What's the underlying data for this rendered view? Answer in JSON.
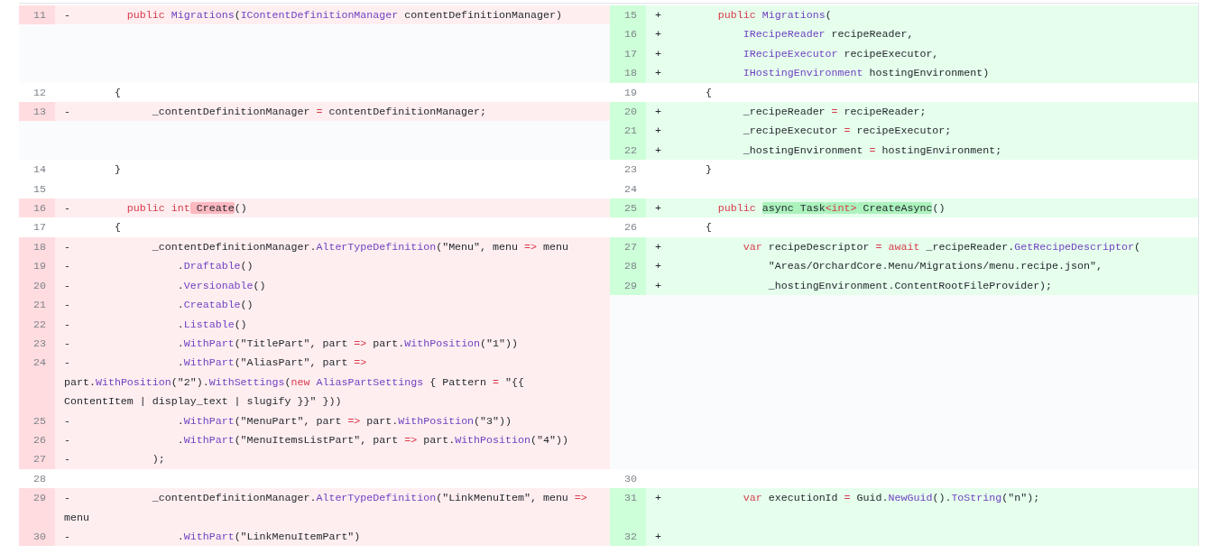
{
  "rows": [
    {
      "left": {
        "number": "11",
        "kind": "del",
        "marker": "-",
        "code": [
          {
            "kind": "keyword",
            "text": "        public"
          },
          {
            "kind": "function",
            "text": " Migrations"
          },
          {
            "kind": "plain",
            "text": "("
          },
          {
            "kind": "function",
            "text": "IContentDefinitionManager"
          },
          {
            "kind": "plain",
            "text": " contentDefinitionManager)"
          }
        ]
      },
      "right": {
        "number": "15",
        "kind": "add",
        "marker": "+",
        "code": [
          {
            "kind": "keyword",
            "text": "        public"
          },
          {
            "kind": "function",
            "text": " Migrations"
          },
          {
            "kind": "plain",
            "text": "("
          }
        ]
      }
    },
    {
      "right": {
        "number": "16",
        "kind": "add",
        "marker": "+",
        "code": [
          {
            "kind": "function",
            "text": "            IRecipeReader"
          },
          {
            "kind": "plain",
            "text": " recipeReader,"
          }
        ]
      }
    },
    {
      "right": {
        "number": "17",
        "kind": "add",
        "marker": "+",
        "code": [
          {
            "kind": "function",
            "text": "            IRecipeExecutor"
          },
          {
            "kind": "plain",
            "text": " recipeExecutor,"
          }
        ]
      }
    },
    {
      "right": {
        "number": "18",
        "kind": "add",
        "marker": "+",
        "code": [
          {
            "kind": "function",
            "text": "            IHostingEnvironment"
          },
          {
            "kind": "plain",
            "text": " hostingEnvironment)"
          }
        ]
      }
    },
    {
      "left": {
        "number": "12",
        "kind": "ctx",
        "code": [
          {
            "kind": "plain",
            "text": "        {"
          }
        ]
      },
      "right": {
        "number": "19",
        "kind": "ctx",
        "code": [
          {
            "kind": "plain",
            "text": "        {"
          }
        ]
      }
    },
    {
      "left": {
        "number": "13",
        "kind": "del",
        "marker": "-",
        "code": [
          {
            "kind": "plain",
            "text": "            _contentDefinitionManager"
          },
          {
            "kind": "keyword",
            "text": " ="
          },
          {
            "kind": "plain",
            "text": " contentDefinitionManager;"
          }
        ]
      },
      "right": {
        "number": "20",
        "kind": "add",
        "marker": "+",
        "code": [
          {
            "kind": "plain",
            "text": "            _recipeReader"
          },
          {
            "kind": "keyword",
            "text": " ="
          },
          {
            "kind": "plain",
            "text": " recipeReader;"
          }
        ]
      }
    },
    {
      "right": {
        "number": "21",
        "kind": "add",
        "marker": "+",
        "code": [
          {
            "kind": "plain",
            "text": "            _recipeExecutor"
          },
          {
            "kind": "keyword",
            "text": " ="
          },
          {
            "kind": "plain",
            "text": " recipeExecutor;"
          }
        ]
      }
    },
    {
      "right": {
        "number": "22",
        "kind": "add",
        "marker": "+",
        "code": [
          {
            "kind": "plain",
            "text": "            _hostingEnvironment"
          },
          {
            "kind": "keyword",
            "text": " ="
          },
          {
            "kind": "plain",
            "text": " hostingEnvironment;"
          }
        ]
      }
    },
    {
      "left": {
        "number": "14",
        "kind": "ctx",
        "code": [
          {
            "kind": "plain",
            "text": "        }"
          }
        ]
      },
      "right": {
        "number": "23",
        "kind": "ctx",
        "code": [
          {
            "kind": "plain",
            "text": "        }"
          }
        ]
      }
    },
    {
      "left": {
        "number": "15",
        "kind": "ctx"
      },
      "right": {
        "number": "24",
        "kind": "ctx"
      }
    },
    {
      "left": {
        "number": "16",
        "kind": "del",
        "marker": "-",
        "code": [
          {
            "kind": "keyword",
            "text": "        public"
          },
          {
            "kind": "keyword",
            "text": " int"
          },
          {
            "kind": "plain",
            "text": " Create",
            "changed": true
          },
          {
            "kind": "plain",
            "text": "()"
          }
        ]
      },
      "right": {
        "number": "25",
        "kind": "add",
        "marker": "+",
        "code": [
          {
            "kind": "keyword",
            "text": "        public "
          },
          {
            "kind": "plain",
            "text": "async Task",
            "changed": true
          },
          {
            "kind": "keyword",
            "text": "<int>",
            "changed": true
          },
          {
            "kind": "plain",
            "text": " CreateAsync",
            "changed": true
          },
          {
            "kind": "plain",
            "text": "()"
          }
        ]
      }
    },
    {
      "left": {
        "number": "17",
        "kind": "ctx",
        "code": [
          {
            "kind": "plain",
            "text": "        {"
          }
        ]
      },
      "right": {
        "number": "26",
        "kind": "ctx",
        "code": [
          {
            "kind": "plain",
            "text": "        {"
          }
        ]
      }
    },
    {
      "left": {
        "number": "18",
        "kind": "del",
        "marker": "-",
        "code": [
          {
            "kind": "plain",
            "text": "            _contentDefinitionManager."
          },
          {
            "kind": "function",
            "text": "AlterTypeDefinition"
          },
          {
            "kind": "plain",
            "text": "(\"Menu\", menu"
          },
          {
            "kind": "keyword",
            "text": " =>"
          },
          {
            "kind": "plain",
            "text": " menu"
          }
        ]
      },
      "right": {
        "number": "27",
        "kind": "add",
        "marker": "+",
        "code": [
          {
            "kind": "keyword",
            "text": "            var"
          },
          {
            "kind": "plain",
            "text": " recipeDescriptor"
          },
          {
            "kind": "keyword",
            "text": " ="
          },
          {
            "kind": "keyword",
            "text": " await"
          },
          {
            "kind": "plain",
            "text": " _recipeReader."
          },
          {
            "kind": "function",
            "text": "GetRecipeDescriptor"
          },
          {
            "kind": "plain",
            "text": "("
          }
        ]
      }
    },
    {
      "left": {
        "number": "19",
        "kind": "del",
        "marker": "-",
        "code": [
          {
            "kind": "plain",
            "text": "                ."
          },
          {
            "kind": "function",
            "text": "Draftable"
          },
          {
            "kind": "plain",
            "text": "()"
          }
        ]
      },
      "right": {
        "number": "28",
        "kind": "add",
        "marker": "+",
        "code": [
          {
            "kind": "plain",
            "text": "                \"Areas/OrchardCore.Menu/Migrations/menu.recipe.json\","
          }
        ]
      }
    },
    {
      "left": {
        "number": "20",
        "kind": "del",
        "marker": "-",
        "code": [
          {
            "kind": "plain",
            "text": "                ."
          },
          {
            "kind": "function",
            "text": "Versionable"
          },
          {
            "kind": "plain",
            "text": "()"
          }
        ]
      },
      "right": {
        "number": "29",
        "kind": "add",
        "marker": "+",
        "code": [
          {
            "kind": "plain",
            "text": "                _hostingEnvironment.ContentRootFileProvider);"
          }
        ]
      }
    },
    {
      "left": {
        "number": "21",
        "kind": "del",
        "marker": "-",
        "code": [
          {
            "kind": "plain",
            "text": "                ."
          },
          {
            "kind": "function",
            "text": "Creatable"
          },
          {
            "kind": "plain",
            "text": "()"
          }
        ]
      }
    },
    {
      "left": {
        "number": "22",
        "kind": "del",
        "marker": "-",
        "code": [
          {
            "kind": "plain",
            "text": "                ."
          },
          {
            "kind": "function",
            "text": "Listable"
          },
          {
            "kind": "plain",
            "text": "()"
          }
        ]
      }
    },
    {
      "left": {
        "number": "23",
        "kind": "del",
        "marker": "-",
        "code": [
          {
            "kind": "plain",
            "text": "                ."
          },
          {
            "kind": "function",
            "text": "WithPart"
          },
          {
            "kind": "plain",
            "text": "(\"TitlePart\", part"
          },
          {
            "kind": "keyword",
            "text": " =>"
          },
          {
            "kind": "plain",
            "text": " part."
          },
          {
            "kind": "function",
            "text": "WithPosition"
          },
          {
            "kind": "plain",
            "text": "(\"1\"))"
          }
        ]
      }
    },
    {
      "left": {
        "number": "24",
        "kind": "del",
        "marker": "-",
        "code": [
          {
            "kind": "plain",
            "text": "                ."
          },
          {
            "kind": "function",
            "text": "WithPart"
          },
          {
            "kind": "plain",
            "text": "(\"AliasPart\", part"
          },
          {
            "kind": "keyword",
            "text": " =>"
          },
          {
            "kind": "plain",
            "text": " part."
          },
          {
            "kind": "function",
            "text": "WithPosition"
          },
          {
            "kind": "plain",
            "text": "(\"2\")."
          },
          {
            "kind": "function",
            "text": "WithSettings"
          },
          {
            "kind": "plain",
            "text": "("
          },
          {
            "kind": "keyword",
            "text": "new"
          },
          {
            "kind": "function",
            "text": " AliasPartSettings"
          },
          {
            "kind": "plain",
            "text": " { Pattern"
          },
          {
            "kind": "keyword",
            "text": " ="
          },
          {
            "kind": "plain",
            "text": " \"{{ ContentItem | display_text | slugify }}\" }))"
          }
        ]
      }
    },
    {
      "left": {
        "number": "25",
        "kind": "del",
        "marker": "-",
        "code": [
          {
            "kind": "plain",
            "text": "                ."
          },
          {
            "kind": "function",
            "text": "WithPart"
          },
          {
            "kind": "plain",
            "text": "(\"MenuPart\", part"
          },
          {
            "kind": "keyword",
            "text": " =>"
          },
          {
            "kind": "plain",
            "text": " part."
          },
          {
            "kind": "function",
            "text": "WithPosition"
          },
          {
            "kind": "plain",
            "text": "(\"3\"))"
          }
        ]
      }
    },
    {
      "left": {
        "number": "26",
        "kind": "del",
        "marker": "-",
        "code": [
          {
            "kind": "plain",
            "text": "                ."
          },
          {
            "kind": "function",
            "text": "WithPart"
          },
          {
            "kind": "plain",
            "text": "(\"MenuItemsListPart\", part"
          },
          {
            "kind": "keyword",
            "text": " =>"
          },
          {
            "kind": "plain",
            "text": " part."
          },
          {
            "kind": "function",
            "text": "WithPosition"
          },
          {
            "kind": "plain",
            "text": "(\"4\"))"
          }
        ]
      }
    },
    {
      "left": {
        "number": "27",
        "kind": "del",
        "marker": "-",
        "code": [
          {
            "kind": "plain",
            "text": "            );"
          }
        ]
      }
    },
    {
      "left": {
        "number": "28",
        "kind": "ctx"
      },
      "right": {
        "number": "30",
        "kind": "ctx"
      }
    },
    {
      "left": {
        "number": "29",
        "kind": "del",
        "marker": "-",
        "code": [
          {
            "kind": "plain",
            "text": "            _contentDefinitionManager."
          },
          {
            "kind": "function",
            "text": "AlterTypeDefinition"
          },
          {
            "kind": "plain",
            "text": "(\"LinkMenuItem\", menu"
          },
          {
            "kind": "keyword",
            "text": " =>"
          },
          {
            "kind": "plain",
            "text": " menu"
          }
        ]
      },
      "right": {
        "number": "31",
        "kind": "add",
        "marker": "+",
        "code": [
          {
            "kind": "keyword",
            "text": "            var"
          },
          {
            "kind": "plain",
            "text": " executionId"
          },
          {
            "kind": "keyword",
            "text": " ="
          },
          {
            "kind": "plain",
            "text": " Guid."
          },
          {
            "kind": "function",
            "text": "NewGuid"
          },
          {
            "kind": "plain",
            "text": "()."
          },
          {
            "kind": "function",
            "text": "ToString"
          },
          {
            "kind": "plain",
            "text": "(\"n\");"
          }
        ]
      }
    },
    {
      "left": {
        "number": "30",
        "kind": "del",
        "marker": "-",
        "code": [
          {
            "kind": "plain",
            "text": "                ."
          },
          {
            "kind": "function",
            "text": "WithPart"
          },
          {
            "kind": "plain",
            "text": "(\"LinkMenuItemPart\")"
          }
        ]
      },
      "right": {
        "number": "32",
        "kind": "add",
        "marker": "+"
      }
    }
  ]
}
